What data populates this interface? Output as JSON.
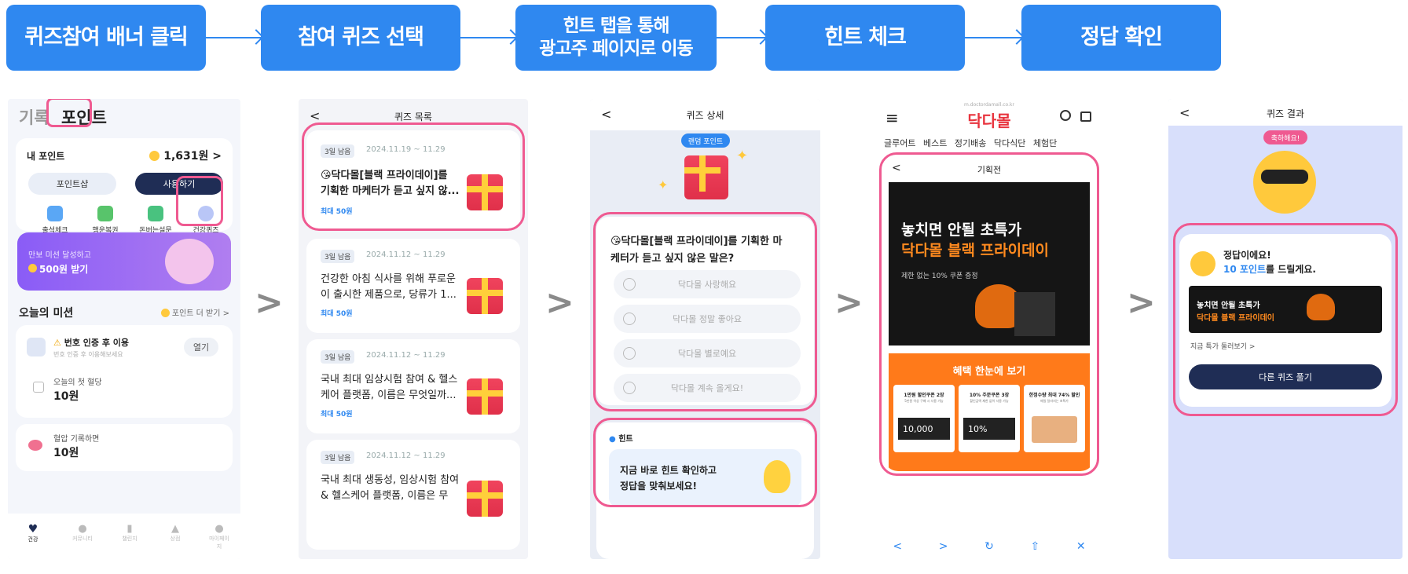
{
  "steps": [
    "퀴즈참여 배너 클릭",
    "참여 퀴즈 선택",
    "힌트 탭을 통해\n광고주 페이지로 이동",
    "힌트 체크",
    "정답 확인"
  ],
  "chevron": ">",
  "s1": {
    "tab_record": "기록",
    "tab_point": "포인트",
    "my_point_label": "내 포인트",
    "my_point_value": "1,631원",
    "caret": ">",
    "point_shop": "포인트샵",
    "use": "사용하기",
    "icons": [
      {
        "label": "출석체크",
        "color": "#5aa7f5",
        "icon": "calendar-icon"
      },
      {
        "label": "행운복권",
        "color": "#58c46b",
        "icon": "clover-icon"
      },
      {
        "label": "돈버는설문",
        "color": "#49c27f",
        "icon": "survey-icon"
      },
      {
        "label": "건강퀴즈",
        "color": "#b9c6f7",
        "icon": "bulb-icon"
      }
    ],
    "banner_line1": "만보 미션 달성하고",
    "banner_line2": "500원 받기",
    "mission_title": "오늘의 미션",
    "mission_more": "포인트 더 받기 >",
    "m1_title": "번호 인증 후 이용",
    "m1_sub": "번호 인증 후 이용해보세요",
    "m1_btn": "열기",
    "m2_title": "오늘의 첫 혈당",
    "m2_value": "10원",
    "m3_title": "혈압 기록하면",
    "m3_value": "10원",
    "nav": [
      "건강",
      "커뮤니티",
      "챌린지",
      "상점",
      "마이페이지"
    ]
  },
  "s2": {
    "title": "퀴즈 목록",
    "back": "<",
    "quizzes": [
      {
        "badge": "3일 남음",
        "date": "2024.11.19 ~ 11.29",
        "title1": "😘닥다몰[블랙 프라이데이]를",
        "title2": "기획한 마케터가 듣고 싶지 않...",
        "pts": "최대 50원"
      },
      {
        "badge": "3일 남음",
        "date": "2024.11.12 ~ 11.29",
        "title1": "건강한 아침 식사를 위해 푸로운",
        "title2": "이 출시한 제품으로, 당류가 1...",
        "pts": "최대 50원"
      },
      {
        "badge": "3일 남음",
        "date": "2024.11.12 ~ 11.29",
        "title1": "국내 최대 임상시험 참여 & 헬스",
        "title2": "케어 플랫폼, 이름은 무엇일까...",
        "pts": "최대 50원"
      },
      {
        "badge": "3일 남음",
        "date": "2024.11.12 ~ 11.29",
        "title1": "국내 최대 생동성, 임상시험 참여",
        "title2": "& 헬스케어 플랫폼, 이름은 무",
        "pts": ""
      }
    ]
  },
  "s3": {
    "title": "퀴즈 상세",
    "back": "<",
    "random": "랜덤 포인트",
    "q1": "😘닥다몰[블랙 프라이데이]를 기획한 마",
    "q2": "케터가 듣고 싶지 않은 말은?",
    "options": [
      "닥다몰 사랑해요",
      "닥다몰 정말 좋아요",
      "닥다몰 별로예요",
      "닥다몰 계속 올게요!"
    ],
    "hint_label": "힌트",
    "hint1": "지금 바로 힌트 확인하고",
    "hint2": "정답을 맞춰보세요!"
  },
  "s4": {
    "url": "m.doctordamall.co.kr",
    "brand": "닥다몰",
    "menu": [
      "글루어트",
      "베스트",
      "정기배송",
      "닥다식단",
      "체험단"
    ],
    "sub_title": "기획전",
    "back": "<",
    "hero1": "놓치면 안될 초특가",
    "hero2": "닥다몰 블랙 프라이데이",
    "hero3": "제한 없는 10% 쿠폰 증정",
    "benefit": "혜택 한눈에 보기",
    "coupons": [
      {
        "t": "1만원 할인쿠폰 2장",
        "s": "5만원 이상 구매 시 사용 가능",
        "v": "10,000"
      },
      {
        "t": "10% 주문쿠폰 3장",
        "s": "할인금액 제한 없이 사용 가능",
        "v": "10%"
      },
      {
        "t": "한정수량 최대 74% 할인",
        "s": "매일 달라지는 초특가",
        "v": ""
      }
    ],
    "browser": [
      "<",
      ">",
      "↻",
      "⇧",
      "✕"
    ]
  },
  "s5": {
    "title": "퀴즈 결과",
    "back": "<",
    "congrats": "축하해요!",
    "correct": "정답이에요!",
    "points_num": "10 포인트",
    "points_rest": "를 드릴게요.",
    "ad1": "놓치면 안될 초특가",
    "ad2": "닥다몰 블랙 프라이데이",
    "browse": "지금 특가 둘러보기 >",
    "other": "다른 퀴즈 풀기"
  }
}
